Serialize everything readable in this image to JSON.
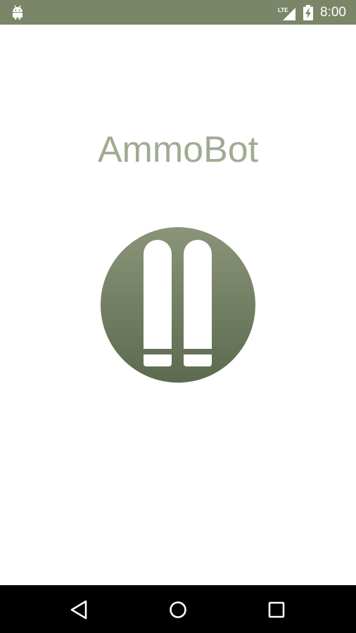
{
  "status_bar": {
    "time": "8:00",
    "network_label": "LTE",
    "left_icon": "android-icon",
    "battery_icon": "battery-charging-icon",
    "background_color": "#7b8669"
  },
  "splash": {
    "app_name": "AmmoBot",
    "title_color": "#a1ab92",
    "logo_icon": "two-cartridges-logo",
    "logo_gradient_top": "#8a9479",
    "logo_gradient_bottom": "#5c6a4f"
  },
  "nav_bar": {
    "buttons": [
      "back-icon",
      "home-icon",
      "recents-icon"
    ],
    "background_color": "#000000"
  }
}
